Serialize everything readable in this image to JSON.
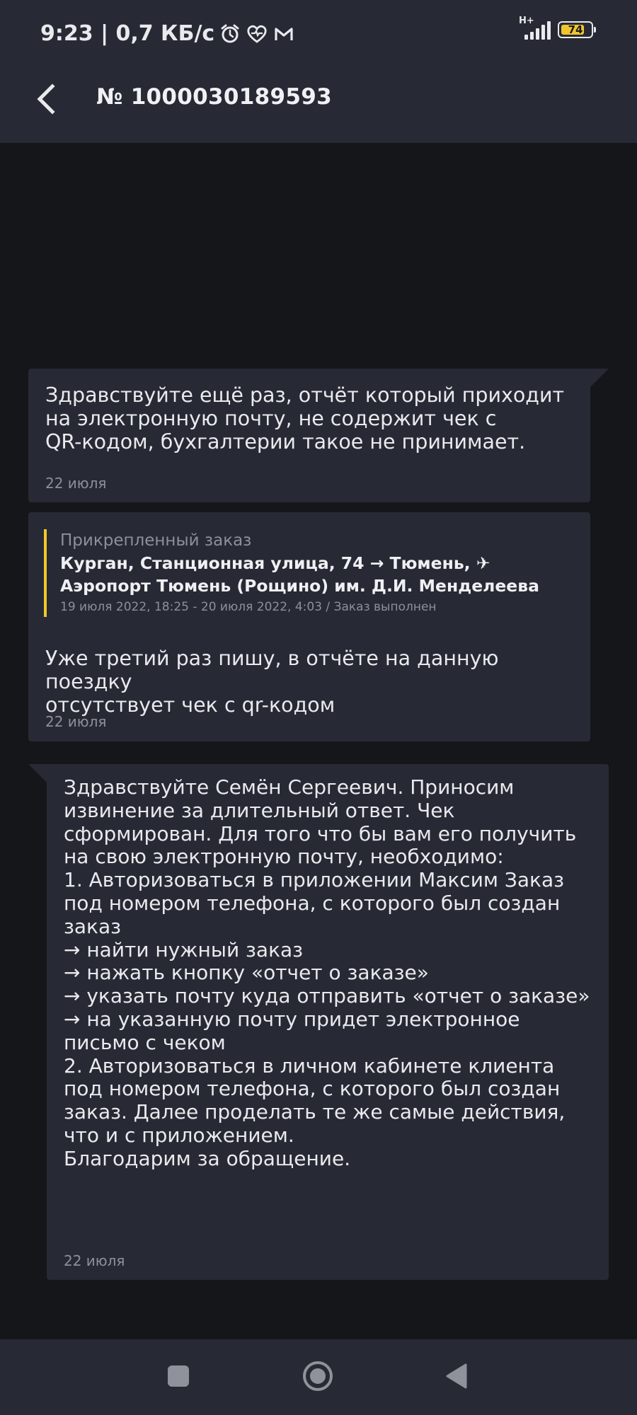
{
  "statusbar": {
    "time_speed": "9:23 | 0,7 КБ/с",
    "network_type": "H+",
    "battery": "74",
    "icons": [
      "alarm-icon",
      "heart-icon",
      "gmail-icon",
      "signal-icon",
      "battery-icon"
    ]
  },
  "header": {
    "title": "№ 1000030189593",
    "back_icon": "chevron-left-icon"
  },
  "messages": [
    {
      "sender": "user",
      "text": "Здравствуйте ещё раз, отчёт который приходит\nна электронную почту, не содержит чек с\nQR-кодом, бухгалтерии такое не принимает.",
      "date": "22 июля"
    },
    {
      "sender": "user",
      "attached_order": {
        "label": "Прикрепленный заказ",
        "route_line1": "Курган, Станционная улица, 74 → Тюмень, ✈",
        "route_line2": "Аэропорт Тюмень (Рощино) им. Д.И. Менделеева",
        "meta": "19 июля 2022, 18:25 - 20 июля 2022, 4:03 / Заказ выполнен"
      },
      "text": "Уже третий раз пишу, в отчёте на данную поездку\nотсутствует чек с qr-кодом",
      "date": "22 июля"
    },
    {
      "sender": "support",
      "text": "Здравствуйте Семён Сергеевич. Приносим\nизвинение за длительный ответ. Чек\nсформирован. Для того что бы вам его получить\nна свою электронную почту, необходимо:\n1. Авторизоваться в приложении Максим Заказ\nпод номером телефона, с которого был создан\nзаказ\n → найти нужный заказ\n → нажать кнопку «отчет о заказе»\n → указать почту куда отправить «отчет о заказе»\n → на указанную почту придет электронное\nписьмо с чеком\n2.  Авторизоваться в личном кабинете клиента\nпод номером телефона, с которого был создан\nзаказ. Далее проделать те же самые действия,\nчто и с приложением.\nБлагодарим за обращение.",
      "date": "22 июля"
    }
  ],
  "navbar": {
    "buttons": [
      "recents-square-icon",
      "home-circle-icon",
      "back-triangle-icon"
    ]
  }
}
